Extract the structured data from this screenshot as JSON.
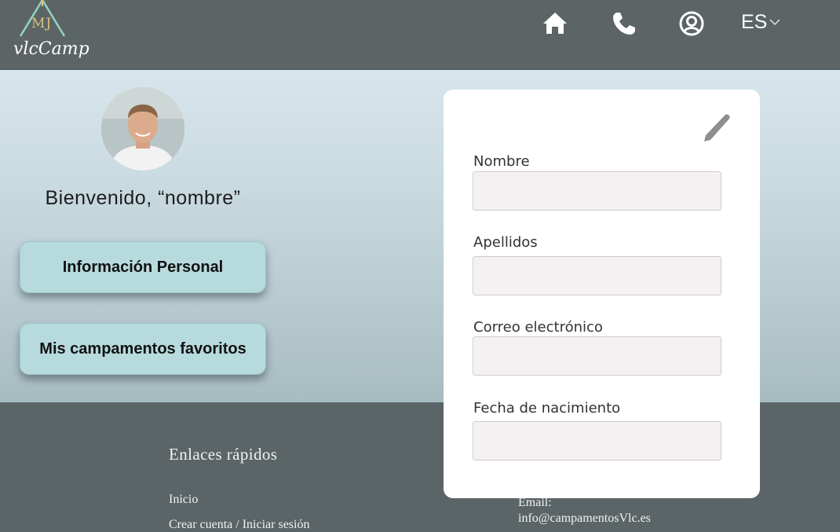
{
  "header": {
    "logo_initials": "MJ",
    "logo_text": "vlcCamp",
    "nav": [
      {
        "name": "home",
        "icon": "home-icon"
      },
      {
        "name": "phone",
        "icon": "phone-icon"
      },
      {
        "name": "account",
        "icon": "user-circle-icon"
      }
    ],
    "language": "ES"
  },
  "profile": {
    "welcome": "Bienvenido, “nombre”",
    "buttons": [
      "Información Personal",
      "Mis campamentos favoritos"
    ]
  },
  "form": {
    "edit_icon": "pencil-icon",
    "fields": [
      {
        "label": "Nombre",
        "value": ""
      },
      {
        "label": "Apellidos",
        "value": ""
      },
      {
        "label": "Correo electrónico",
        "value": ""
      },
      {
        "label": "Fecha de nacimiento",
        "value": ""
      }
    ]
  },
  "footer": {
    "links_title": "Enlaces rápidos",
    "links": [
      "Inicio",
      "Crear cuenta / Iniciar sesión"
    ],
    "contact": {
      "email_label": "Email:",
      "email": "info@campamentosVlc.es"
    }
  },
  "colors": {
    "header_bg": "#5d6466",
    "button_bg": "#b7dadd",
    "footer_bg": "#5b6466"
  }
}
